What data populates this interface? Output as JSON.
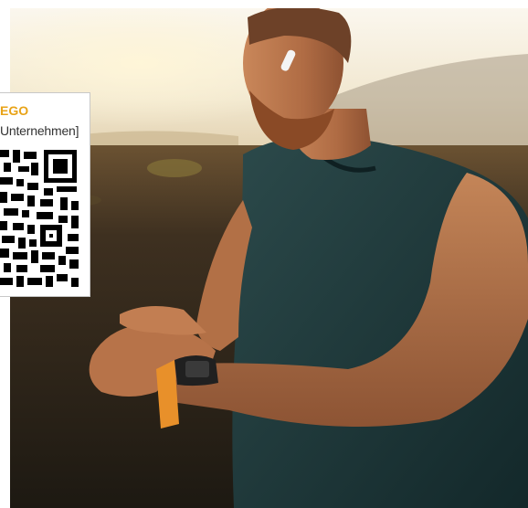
{
  "qr_card": {
    "brand": "EGO",
    "subtitle": "Unternehmen]"
  },
  "colors": {
    "brand_accent": "#e8a317",
    "shirt": "#1f3a3c",
    "watch_band": "#e8902a",
    "sky": "#f3ecd9"
  },
  "icons": [
    "qr-code-icon"
  ]
}
